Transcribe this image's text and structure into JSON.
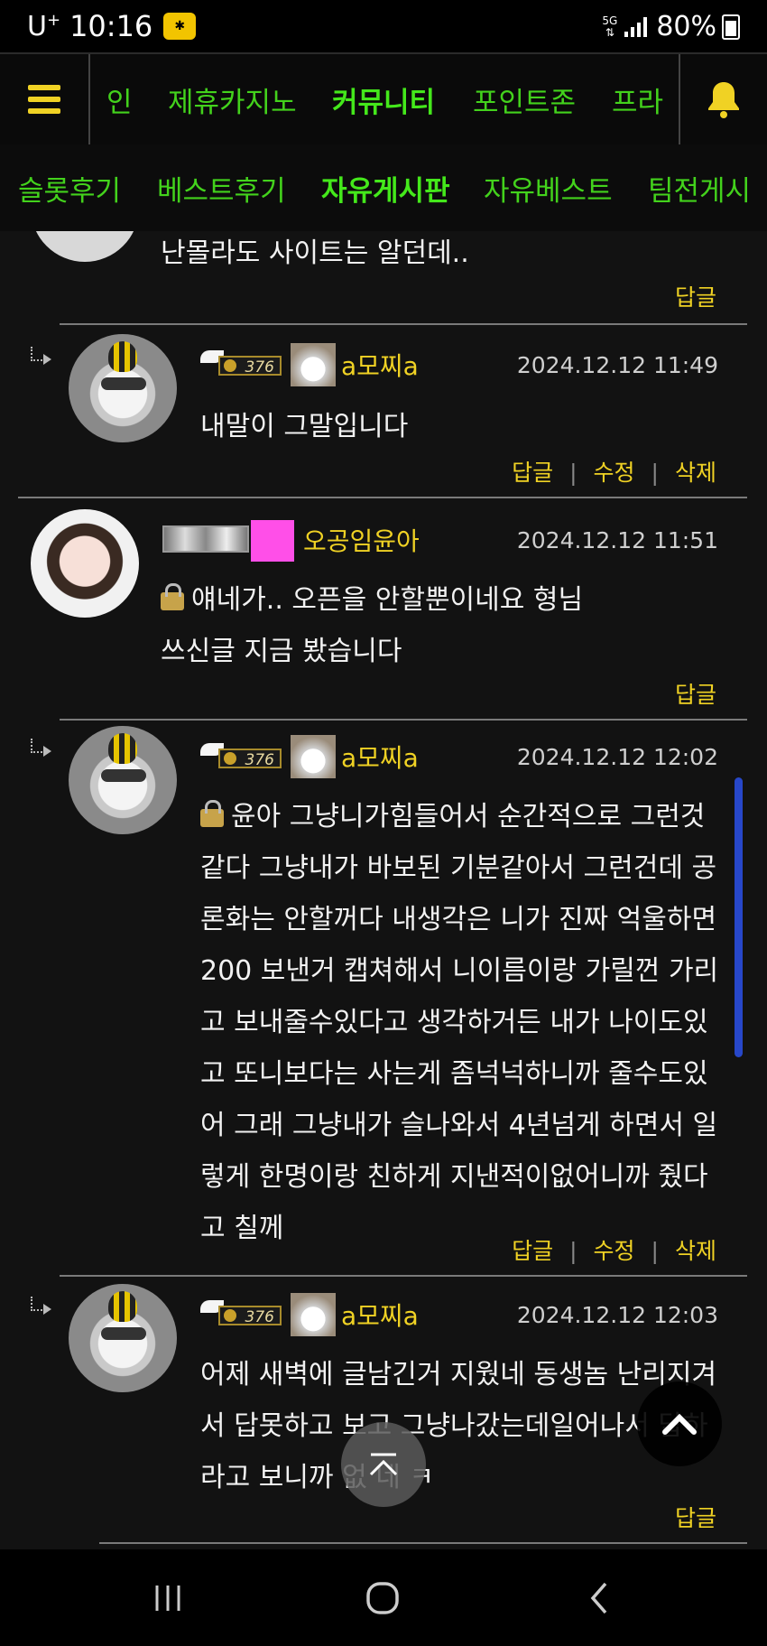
{
  "status_bar": {
    "carrier": "U",
    "carrier_sup": "+",
    "time": "10:16",
    "network": "5G",
    "battery": "80%"
  },
  "top_nav": {
    "items": [
      {
        "label": "인",
        "active": false
      },
      {
        "label": "제휴카지노",
        "active": false
      },
      {
        "label": "커뮤니티",
        "active": true
      },
      {
        "label": "포인트존",
        "active": false
      },
      {
        "label": "프라",
        "active": false
      }
    ]
  },
  "sub_nav": {
    "items": [
      {
        "label": "슬롯후기",
        "active": false
      },
      {
        "label": "베스트후기",
        "active": false
      },
      {
        "label": "자유게시판",
        "active": true
      },
      {
        "label": "자유베스트",
        "active": false
      },
      {
        "label": "팀전게시",
        "active": false
      }
    ]
  },
  "comments": [
    {
      "body_lines": [
        "난몰라도 사이트는 알던데.."
      ],
      "actions": [
        "답글"
      ]
    },
    {
      "level": "376",
      "nickname": "a모찌a",
      "date": "2024.12.12 11:49",
      "body_lines": [
        "내말이  그말입니다"
      ],
      "actions": [
        "답글",
        "수정",
        "삭제"
      ]
    },
    {
      "nickname": "오공임윤아",
      "date": "2024.12.12 11:51",
      "body_lines": [
        "얘네가.. 오픈을 안할뿐이네요 형님",
        "쓰신글 지금 봤습니다"
      ],
      "actions": [
        "답글"
      ]
    },
    {
      "level": "376",
      "nickname": "a모찌a",
      "date": "2024.12.12 12:02",
      "body_lines": [
        "윤아 그냥니가힘들어서 순간적으로 그런것",
        "같다  그냥내가 바보된 기분같아서 그런건데 공",
        "론화는 안할꺼다 내생각은 니가 진짜 억울하면",
        "200 보낸거 캡쳐해서 니이름이랑 가릴껀 가리",
        "고 보내줄수있다고 생각하거든 내가 나이도있",
        "고 또니보다는 사는게 좀넉넉하니까 줄수도있",
        "어 그래 그냥내가 슬나와서 4년넘게 하면서 일",
        "렇게 한명이랑 친하게 지낸적이없어니까 줬다",
        "고 칠께"
      ],
      "actions": [
        "답글",
        "수정",
        "삭제"
      ]
    },
    {
      "level": "376",
      "nickname": "a모찌a",
      "date": "2024.12.12 12:03",
      "body_lines": [
        "어제 새벽에 글남긴거 지웠네 동생놈 난리지겨",
        "서 답못하고 보고 그냥나갔는데일어나서 답하",
        "라고 보니까 없   네 ㅋ"
      ],
      "actions": [
        "답글"
      ]
    }
  ],
  "colors": {
    "accent_green": "#43d21c",
    "accent_yellow": "#f0d224",
    "background": "#121212",
    "scroll": "#2747c9"
  },
  "icons": {
    "menu": "hamburger-icon",
    "bell": "bell-icon",
    "scroll_top": "scroll-top-icon",
    "up": "chevron-up-icon",
    "lock": "lock-icon",
    "reply": "reply-arrow-icon"
  }
}
